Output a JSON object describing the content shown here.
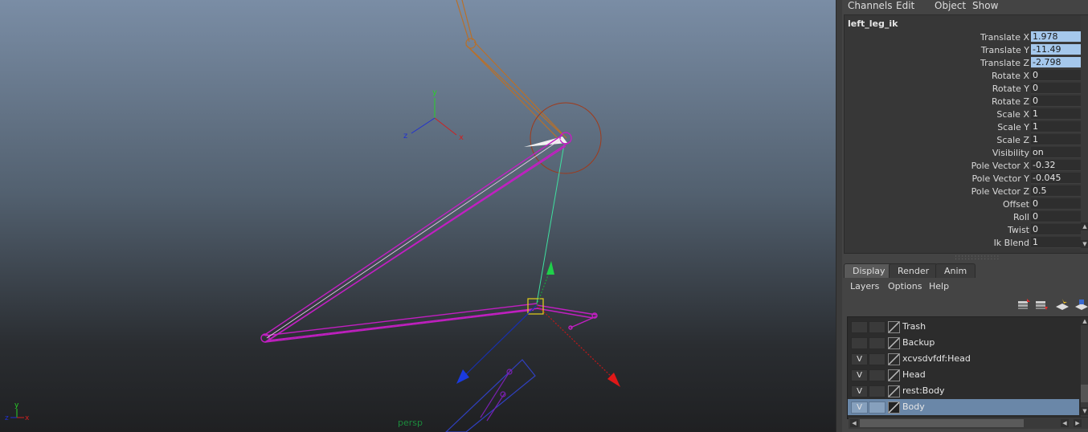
{
  "menubar": {
    "items": [
      "Channels",
      "Edit",
      "Object",
      "Show"
    ]
  },
  "viewport": {
    "camera_label": "persp",
    "axis_labels": {
      "x": "x",
      "y": "y",
      "z": "z"
    }
  },
  "channel_box": {
    "object_name": "left_leg_ik",
    "attributes": [
      {
        "label": "Translate X",
        "value": "1.978",
        "selected": true
      },
      {
        "label": "Translate Y",
        "value": "-11.49",
        "selected": true
      },
      {
        "label": "Translate Z",
        "value": "-2.798",
        "selected": true
      },
      {
        "label": "Rotate X",
        "value": "0",
        "selected": false
      },
      {
        "label": "Rotate Y",
        "value": "0",
        "selected": false
      },
      {
        "label": "Rotate Z",
        "value": "0",
        "selected": false
      },
      {
        "label": "Scale X",
        "value": "1",
        "selected": false
      },
      {
        "label": "Scale Y",
        "value": "1",
        "selected": false
      },
      {
        "label": "Scale Z",
        "value": "1",
        "selected": false
      },
      {
        "label": "Visibility",
        "value": "on",
        "selected": false
      },
      {
        "label": "Pole Vector X",
        "value": "-0.32",
        "selected": false
      },
      {
        "label": "Pole Vector Y",
        "value": "-0.045",
        "selected": false
      },
      {
        "label": "Pole Vector Z",
        "value": "0.5",
        "selected": false
      },
      {
        "label": "Offset",
        "value": "0",
        "selected": false
      },
      {
        "label": "Roll",
        "value": "0",
        "selected": false
      },
      {
        "label": "Twist",
        "value": "0",
        "selected": false
      },
      {
        "label": "Ik Blend",
        "value": "1",
        "selected": false
      }
    ]
  },
  "layer_editor": {
    "tabs": [
      {
        "label": "Display",
        "active": true
      },
      {
        "label": "Render",
        "active": false
      },
      {
        "label": "Anim",
        "active": false
      }
    ],
    "menu": [
      "Layers",
      "Options",
      "Help"
    ],
    "icons": [
      "layer-up-icon",
      "layer-down-icon",
      "new-layer-icon",
      "new-layer-selected-icon"
    ],
    "layers": [
      {
        "name": "Trash",
        "visible": "",
        "selected": false
      },
      {
        "name": "Backup",
        "visible": "",
        "selected": false
      },
      {
        "name": "xcvsdvfdf:Head",
        "visible": "V",
        "selected": false
      },
      {
        "name": "Head",
        "visible": "V",
        "selected": false
      },
      {
        "name": "rest:Body",
        "visible": "V",
        "selected": false
      },
      {
        "name": "Body",
        "visible": "V",
        "selected": true
      }
    ]
  },
  "colors": {
    "selection_blue": "#a5c8ec",
    "joint_magenta": "#c21fc2",
    "bone_orange": "#b8702a",
    "pole_vector_green": "#3fe0a0"
  }
}
